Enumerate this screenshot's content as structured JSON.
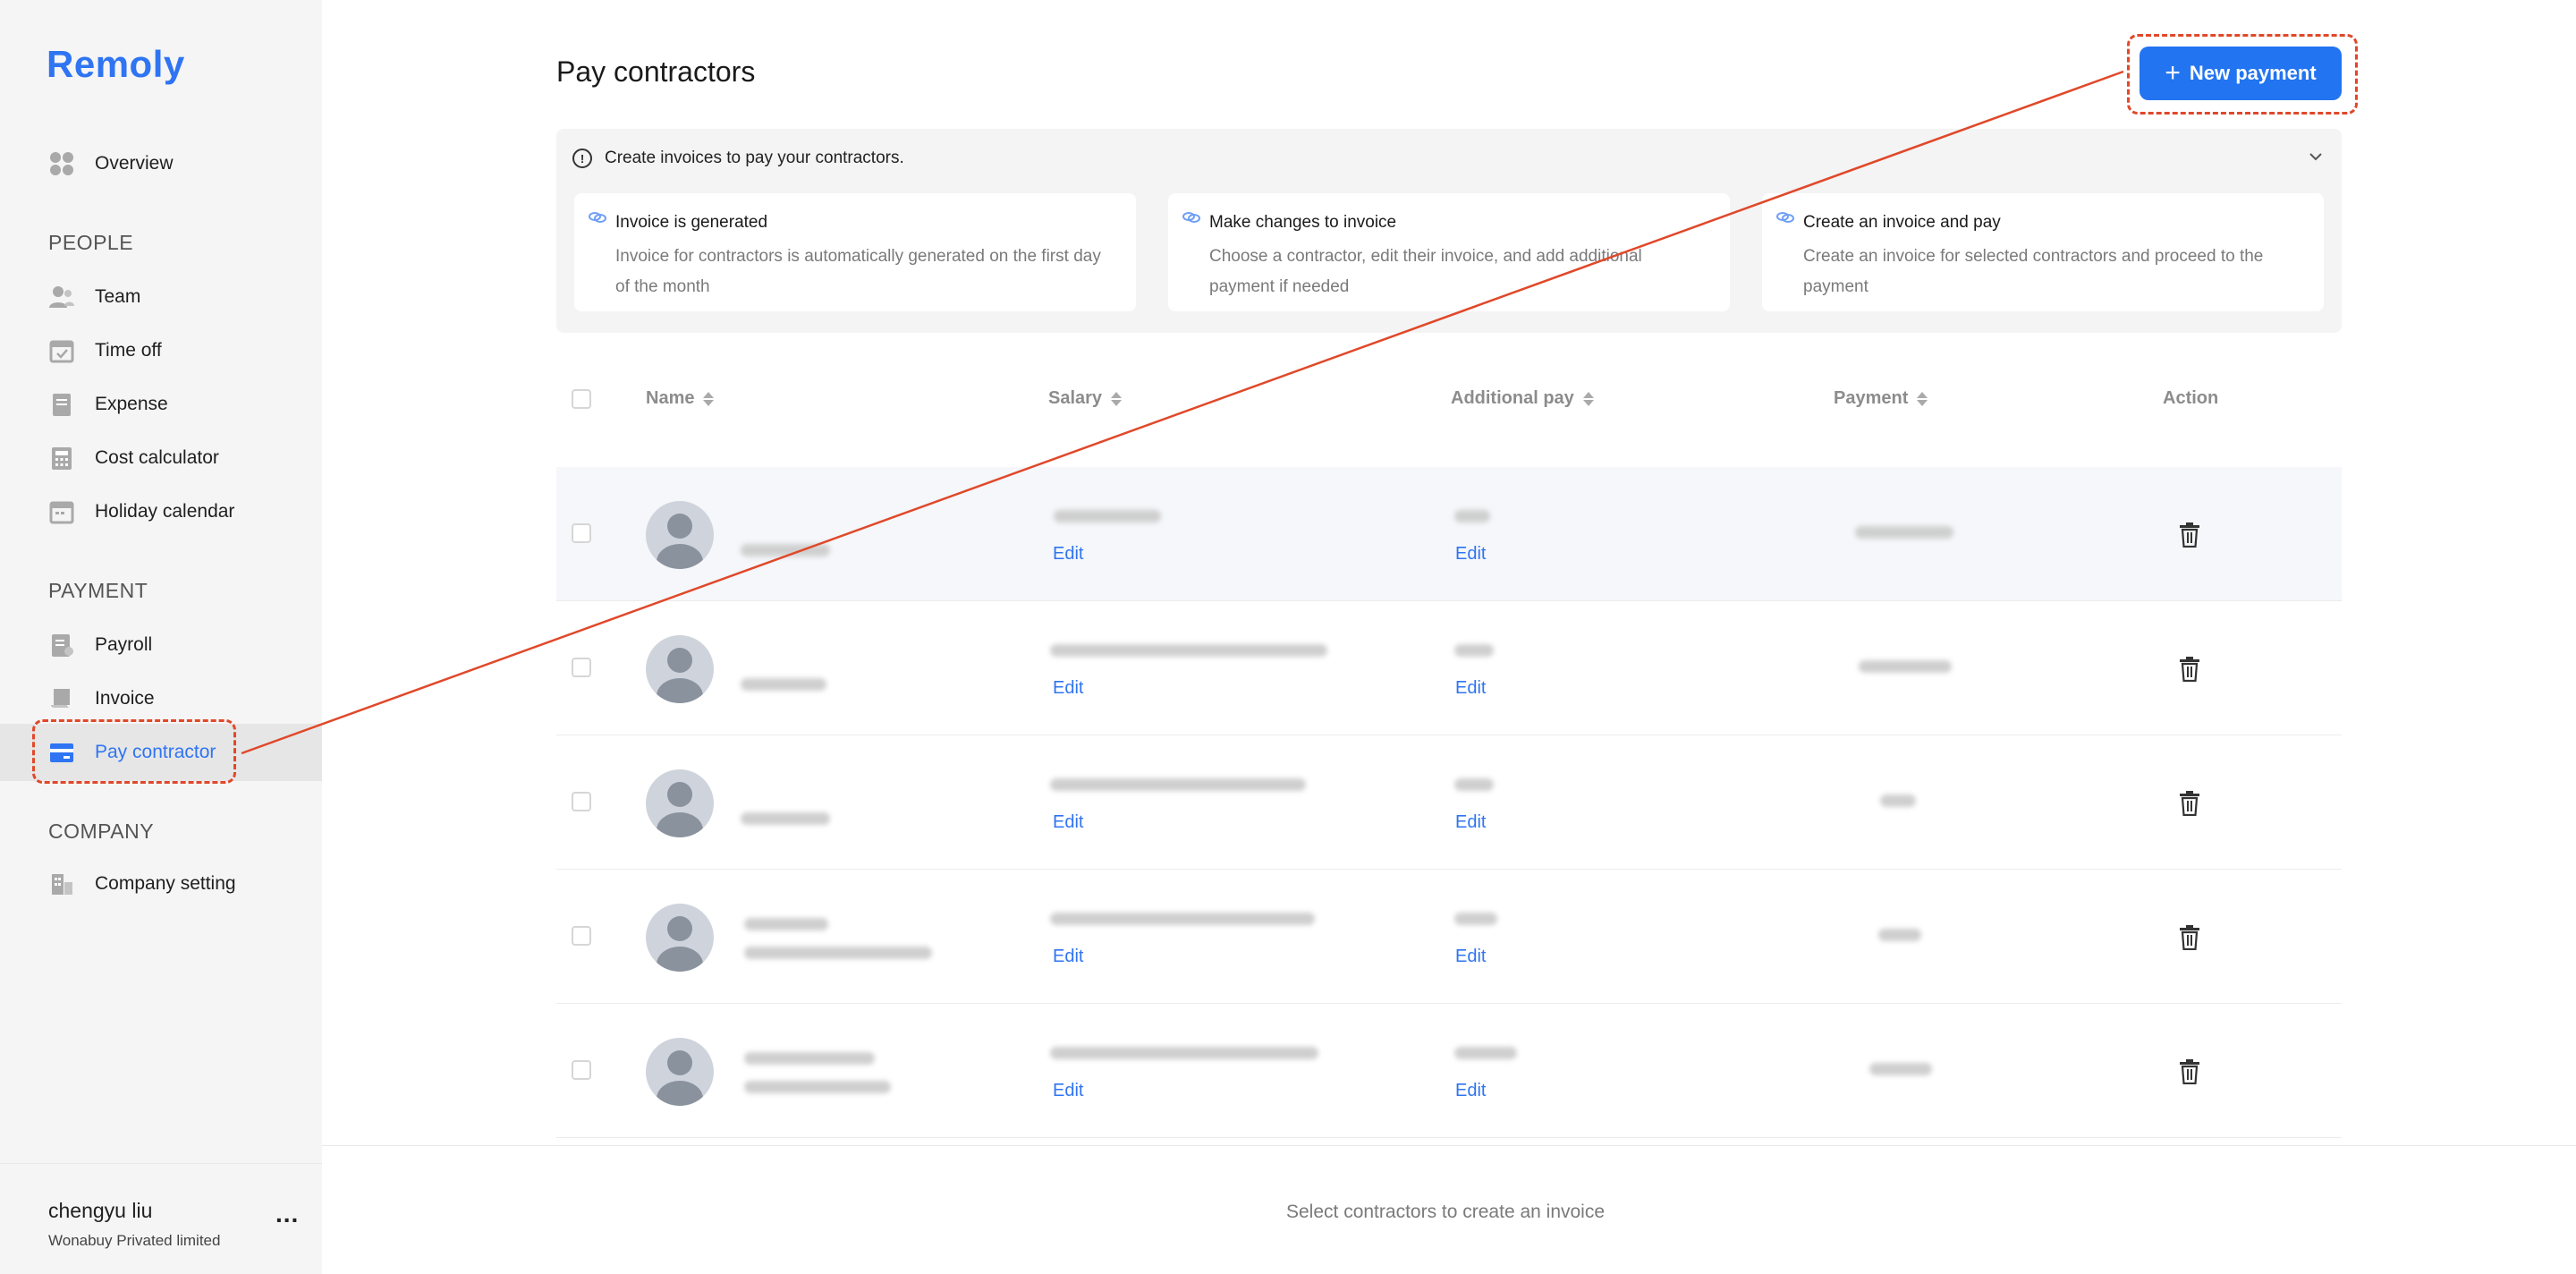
{
  "app": {
    "logo": "Remoly"
  },
  "sidebar": {
    "overview": "Overview",
    "sections": {
      "people": "PEOPLE",
      "payment": "PAYMENT",
      "company": "COMPANY"
    },
    "people_items": [
      {
        "label": "Team",
        "icon": "team-icon"
      },
      {
        "label": "Time off",
        "icon": "calendar-check-icon"
      },
      {
        "label": "Expense",
        "icon": "receipt-icon"
      },
      {
        "label": "Cost calculator",
        "icon": "calculator-icon"
      },
      {
        "label": "Holiday calendar",
        "icon": "calendar-icon"
      }
    ],
    "payment_items": [
      {
        "label": "Payroll",
        "icon": "document-icon"
      },
      {
        "label": "Invoice",
        "icon": "scroll-icon"
      },
      {
        "label": "Pay contractor",
        "icon": "card-icon",
        "active": true
      }
    ],
    "company_items": [
      {
        "label": "Company setting",
        "icon": "building-icon"
      }
    ],
    "user": {
      "name": "chengyu liu",
      "company": "Wonabuy Privated limited",
      "menu": "..."
    }
  },
  "page": {
    "title": "Pay contractors",
    "new_payment": "New payment",
    "new_payment_plus": "+"
  },
  "info": {
    "heading": "Create invoices to pay your contractors.",
    "cards": [
      {
        "title": "Invoice is generated",
        "desc": "Invoice for contractors is automatically generated on the first day of the month"
      },
      {
        "title": "Make changes to invoice",
        "desc": "Choose a contractor, edit their invoice, and add additional payment if needed"
      },
      {
        "title": "Create an invoice and pay",
        "desc": "Create an invoice for selected contractors and proceed to the payment"
      }
    ]
  },
  "table": {
    "columns": {
      "name": "Name",
      "salary": "Salary",
      "additional": "Additional pay",
      "payment": "Payment",
      "action": "Action"
    },
    "edit_label": "Edit",
    "row_count": 5
  },
  "footer": {
    "hint": "Select contractors to create an invoice"
  },
  "colors": {
    "accent": "#2274f0",
    "annotation": "#e0482a"
  }
}
